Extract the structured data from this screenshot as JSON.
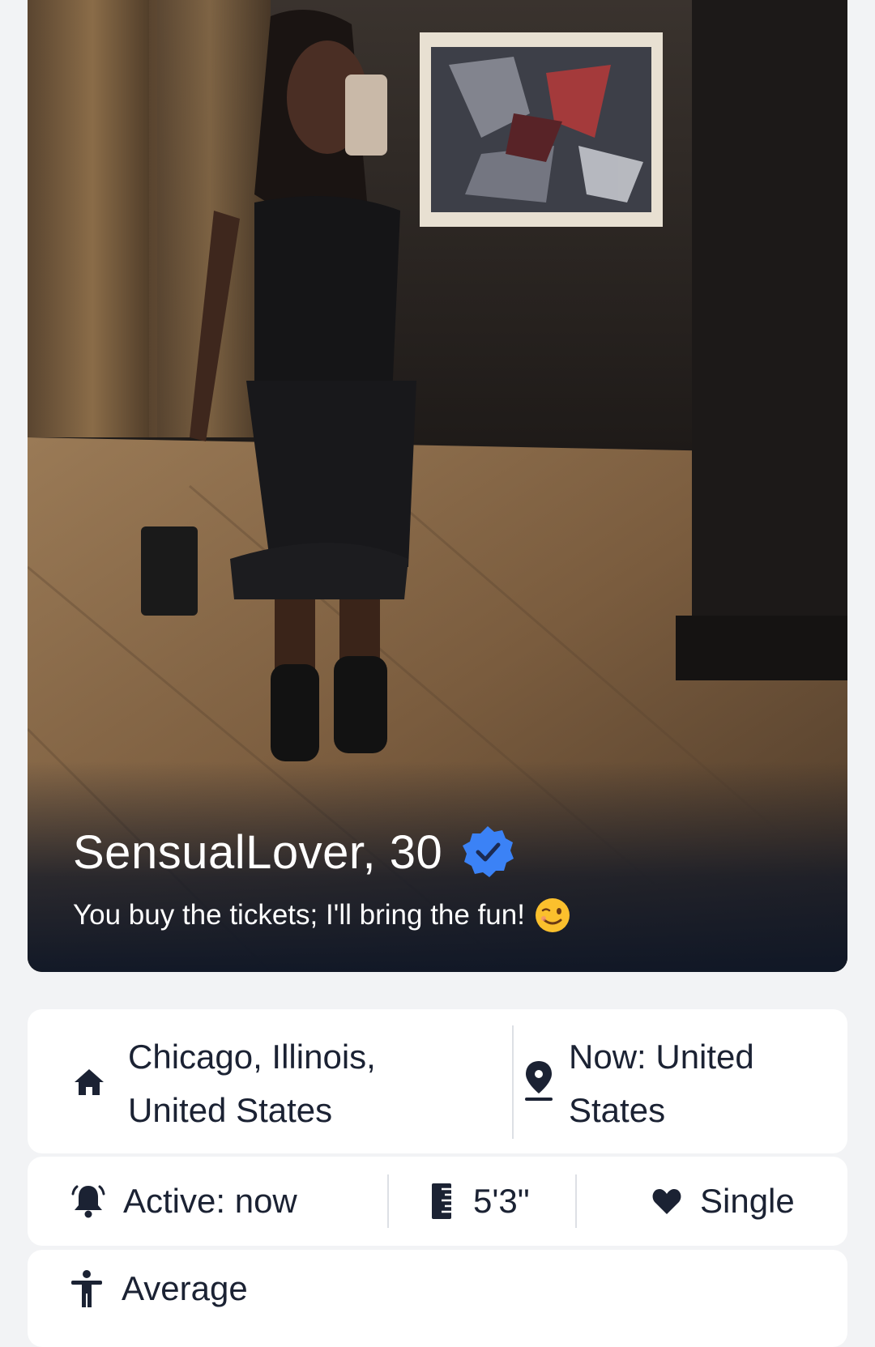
{
  "profile": {
    "name_age": "SensualLover, 30",
    "tagline": "You buy the tickets; I'll bring the fun!",
    "verified": true
  },
  "location": {
    "hometown_line1": "Chicago, Illinois,",
    "hometown_line2": "United States",
    "current_line1": "Now: United",
    "current_line2": "States"
  },
  "stats": {
    "active": "Active: now",
    "height": "5'3\"",
    "relationship": "Single"
  },
  "body": {
    "type": "Average"
  },
  "icons": {
    "verified": "verified-badge-icon",
    "tagline_emoji": "winking-face-icon",
    "hometown": "home-icon",
    "current_location": "location-pin-icon",
    "active": "bell-icon",
    "height": "ruler-icon",
    "relationship": "heart-icon",
    "body": "person-icon"
  },
  "colors": {
    "accent_blue": "#3b82f6",
    "text_dark": "#1b2233",
    "page_bg": "#f2f3f5",
    "card_bg": "#ffffff"
  }
}
